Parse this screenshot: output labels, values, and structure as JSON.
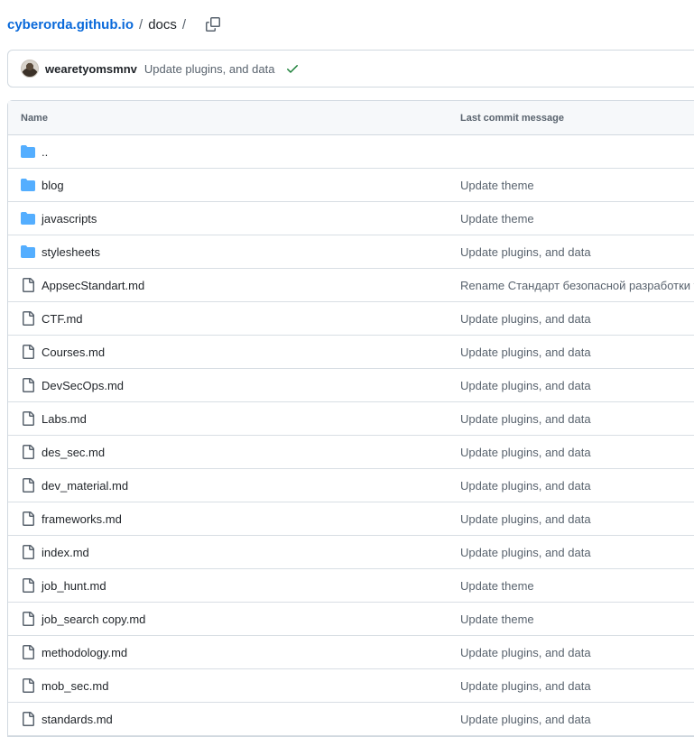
{
  "breadcrumb": {
    "repo": "cyberorda.github.io",
    "separator": "/",
    "folder": "docs",
    "trailing_separator": "/"
  },
  "latest_commit": {
    "author": "wearetyomsmnv",
    "message": "Update plugins, and data",
    "status": "check-icon"
  },
  "table": {
    "columns": [
      "Name",
      "Last commit message"
    ],
    "rows": [
      {
        "name": "..",
        "type": "folder",
        "message": ""
      },
      {
        "name": "blog",
        "type": "folder",
        "message": "Update theme"
      },
      {
        "name": "javascripts",
        "type": "folder",
        "message": "Update theme"
      },
      {
        "name": "stylesheets",
        "type": "folder",
        "message": "Update plugins, and data"
      },
      {
        "name": "AppsecStandart.md",
        "type": "file",
        "message": "Rename Стандарт безопасной разработки to"
      },
      {
        "name": "CTF.md",
        "type": "file",
        "message": "Update plugins, and data"
      },
      {
        "name": "Courses.md",
        "type": "file",
        "message": "Update plugins, and data"
      },
      {
        "name": "DevSecOps.md",
        "type": "file",
        "message": "Update plugins, and data"
      },
      {
        "name": "Labs.md",
        "type": "file",
        "message": "Update plugins, and data"
      },
      {
        "name": "des_sec.md",
        "type": "file",
        "message": "Update plugins, and data"
      },
      {
        "name": "dev_material.md",
        "type": "file",
        "message": "Update plugins, and data"
      },
      {
        "name": "frameworks.md",
        "type": "file",
        "message": "Update plugins, and data"
      },
      {
        "name": "index.md",
        "type": "file",
        "message": "Update plugins, and data"
      },
      {
        "name": "job_hunt.md",
        "type": "file",
        "message": "Update theme"
      },
      {
        "name": "job_search copy.md",
        "type": "file",
        "message": "Update theme"
      },
      {
        "name": "methodology.md",
        "type": "file",
        "message": "Update plugins, and data"
      },
      {
        "name": "mob_sec.md",
        "type": "file",
        "message": "Update plugins, and data"
      },
      {
        "name": "standards.md",
        "type": "file",
        "message": "Update plugins, and data"
      }
    ]
  },
  "colors": {
    "link": "#0969da",
    "folder_icon": "#54aeff",
    "success": "#1a7f37",
    "muted": "#59636e"
  }
}
